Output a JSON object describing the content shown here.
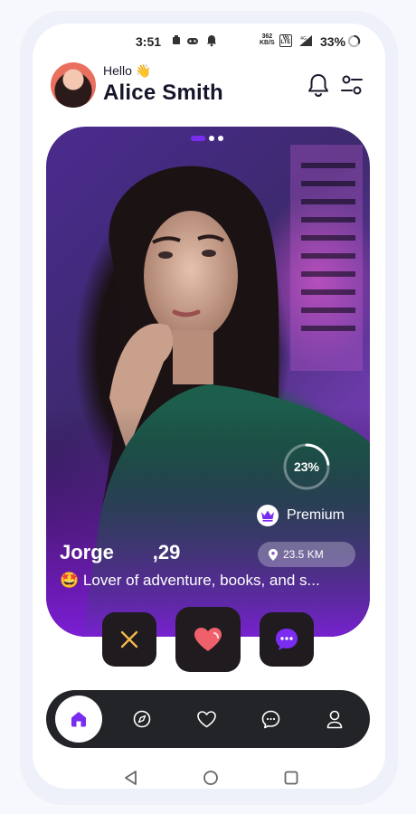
{
  "status_bar": {
    "time": "3:51",
    "speed_value": "362",
    "speed_unit": "KB/S",
    "volte_top": "Vo",
    "volte_bottom": "LTE",
    "network": "4G",
    "battery": "33%"
  },
  "header": {
    "greeting": "Hello",
    "greeting_emoji": "👋",
    "user_name": "Alice Smith"
  },
  "card": {
    "photos_total": 3,
    "photo_active": 1,
    "match_percent": "23%",
    "match_value": 0.23,
    "premium_label": "Premium",
    "name": "Jorge",
    "age": ",29",
    "distance": "23.5 KM",
    "bio_emoji": "🤩",
    "bio": "Lover of adventure, books, and s..."
  },
  "actions": {
    "dislike_icon": "close-icon",
    "like_icon": "heart-icon",
    "message_icon": "chat-bubble-icon"
  },
  "bottom_nav": {
    "items": [
      "home",
      "explore",
      "likes",
      "chat",
      "profile"
    ],
    "active": "home"
  },
  "colors": {
    "accent": "#7a2cf0",
    "dark": "#201b1f",
    "like": "#f0606b",
    "dislike": "#f2b94a"
  }
}
